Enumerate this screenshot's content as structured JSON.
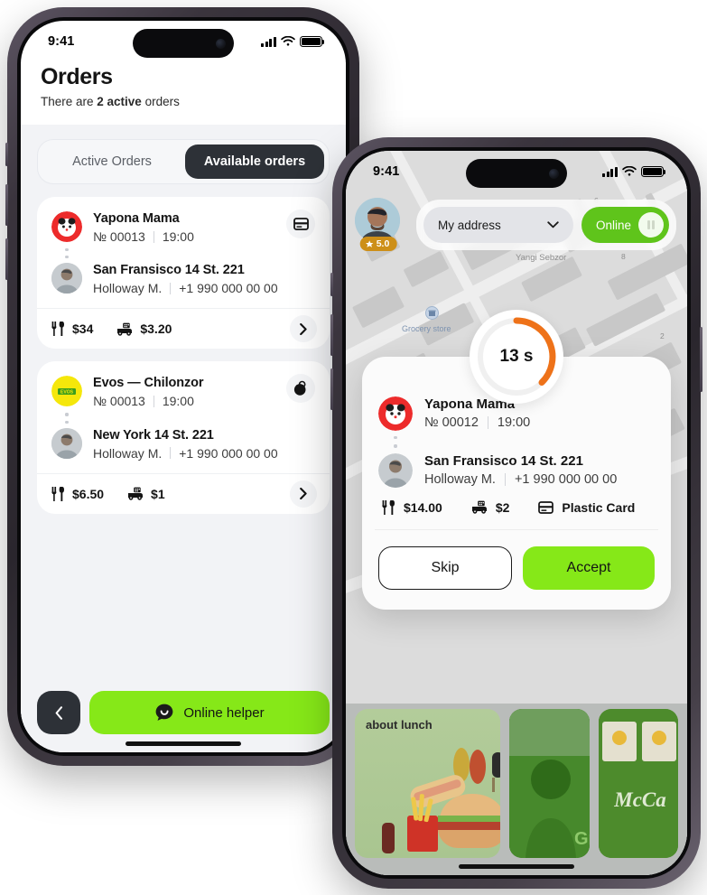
{
  "left_phone": {
    "status_bar": {
      "time": "9:41",
      "signal_icon": "cellular-bars-icon",
      "wifi_icon": "wifi-icon",
      "battery_icon": "battery-icon"
    },
    "header": {
      "title": "Orders",
      "subtitle_prefix": "There are ",
      "subtitle_strong": "2 active",
      "subtitle_suffix": " orders"
    },
    "tabs": [
      {
        "label": "Active Orders",
        "active": false
      },
      {
        "label": "Available orders",
        "active": true
      }
    ],
    "orders": [
      {
        "restaurant": "Yapona Mama",
        "order_no": "№ 00013",
        "time": "19:00",
        "address": "San Fransisco 14 St. 221",
        "customer": "Holloway M.",
        "phone": "+1 990 000 00 00",
        "food_price": "$34",
        "delivery_price": "$3.20",
        "payment_icon": "credit-card-icon",
        "logo": "yapona-mama-logo"
      },
      {
        "restaurant": "Evos — Chilonzor",
        "order_no": "№ 00013",
        "time": "19:00",
        "address": "New York 14 St. 221",
        "customer": "Holloway M.",
        "phone": "+1 990 000 00 00",
        "food_price": "$6.50",
        "delivery_price": "$1",
        "payment_icon": "cash-coin-icon",
        "logo": "evos-logo",
        "logo_text": "EVOS"
      }
    ],
    "footer": {
      "back_icon": "chevron-left-icon",
      "helper_label": "Online helper",
      "helper_icon": "chat-bubble-icon"
    }
  },
  "right_phone": {
    "status_bar": {
      "time": "9:41",
      "signal_icon": "cellular-bars-icon",
      "wifi_icon": "wifi-icon",
      "battery_icon": "battery-icon"
    },
    "driver": {
      "rating": "5.0",
      "rating_icon": "star-icon",
      "avatar": "driver-avatar"
    },
    "address_select": {
      "value": "My address",
      "chevron_icon": "chevron-down-icon"
    },
    "online_toggle": {
      "label": "Online",
      "state": "on",
      "knob_icon": "pause-icon"
    },
    "map": {
      "labels": [
        "Yangi Sebzor",
        "Grocery store"
      ],
      "poi_icon": "store-icon",
      "street_numbers": [
        "6",
        "8",
        "2"
      ]
    },
    "modal": {
      "timer_value": "13 s",
      "timer_accent": "#ee7219",
      "restaurant": "Yapona Mama",
      "order_no": "№ 00012",
      "time": "19:00",
      "address": "San Fransisco 14 St. 221",
      "customer": "Holloway M.",
      "phone": "+1 990 000 00 00",
      "food_price": "$14.00",
      "food_icon": "cutlery-icon",
      "delivery_price": "$2",
      "delivery_icon": "scooter-icon",
      "payment_method": "Plastic Card",
      "payment_icon": "credit-card-icon",
      "skip_label": "Skip",
      "accept_label": "Accept"
    },
    "promo": {
      "headline": "about lunch",
      "cards": [
        "burger-fries-promo",
        "courier-green-promo",
        "mccafe-promo"
      ],
      "mccafe_text": "McCa"
    }
  },
  "colors": {
    "accent_green": "#86e818",
    "toggle_green": "#5fc41b",
    "dark": "#2d3137",
    "timer_orange": "#ee7219",
    "rating_gold": "#cd8f18",
    "page_bg": "#f2f3f6"
  }
}
